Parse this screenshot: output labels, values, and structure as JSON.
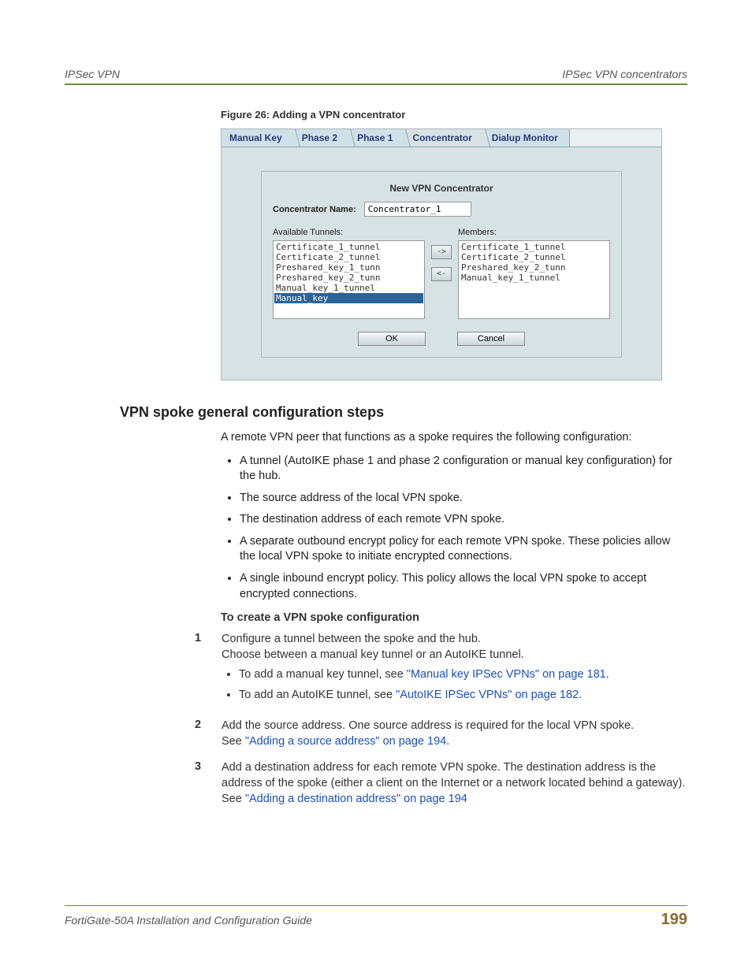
{
  "header": {
    "left": "IPSec VPN",
    "right": "IPSec VPN concentrators"
  },
  "figure": {
    "caption": "Figure 26: Adding a VPN concentrator",
    "tabs": [
      "Manual Key",
      "Phase 2",
      "Phase 1",
      "Concentrator",
      "Dialup Monitor"
    ],
    "form": {
      "title": "New VPN Concentrator",
      "name_label": "Concentrator Name:",
      "name_value": "Concentrator_1",
      "available_label": "Available Tunnels:",
      "members_label": "Members:",
      "available": [
        "Certificate_1_tunnel",
        "Certificate_2_tunnel",
        "Preshared_key_1_tunn",
        "Preshared_key_2_tunn",
        "Manual_key_1_tunnel",
        "Manual_key"
      ],
      "members": [
        "Certificate_1_tunnel",
        "Certificate_2_tunnel",
        "Preshared_key_2_tunn",
        "Manual_key_1_tunnel"
      ],
      "btn_right": "->",
      "btn_left": "<-",
      "ok": "OK",
      "cancel": "Cancel"
    }
  },
  "section": {
    "heading": "VPN spoke general configuration steps",
    "intro": "A remote VPN peer that functions as a spoke requires the following configuration:",
    "bullets": [
      "A tunnel (AutoIKE phase 1 and phase 2 configuration or manual key configuration) for the hub.",
      "The source address of the local VPN spoke.",
      "The destination address of each remote VPN spoke.",
      "A separate outbound encrypt policy for each remote VPN spoke. These policies allow the local VPN spoke to initiate encrypted connections.",
      "A single inbound encrypt policy. This policy allows the local VPN spoke to accept encrypted connections."
    ],
    "sub_heading": "To create a VPN spoke configuration",
    "steps": {
      "s1": {
        "num": "1",
        "line1": "Configure a tunnel between the spoke and the hub.",
        "line2": "Choose between a manual key tunnel or an AutoIKE tunnel.",
        "sb1_pre": "To add a manual key tunnel, see ",
        "sb1_link": "\"Manual key IPSec VPNs\" on page 181",
        "sb2_pre": "To add an AutoIKE tunnel, see ",
        "sb2_link": "\"AutoIKE IPSec VPNs\" on page 182"
      },
      "s2": {
        "num": "2",
        "line1": "Add the source address. One source address is required for the local VPN spoke.",
        "see": "See ",
        "link": "\"Adding a source address\" on page 194"
      },
      "s3": {
        "num": "3",
        "line1": "Add a destination address for each remote VPN spoke. The destination address is the address of the spoke (either a client on the Internet or a network located behind a gateway).",
        "see": "See ",
        "link": "\"Adding a destination address\" on page 194"
      }
    }
  },
  "footer": {
    "left": "FortiGate-50A Installation and Configuration Guide",
    "page": "199"
  },
  "period": "."
}
